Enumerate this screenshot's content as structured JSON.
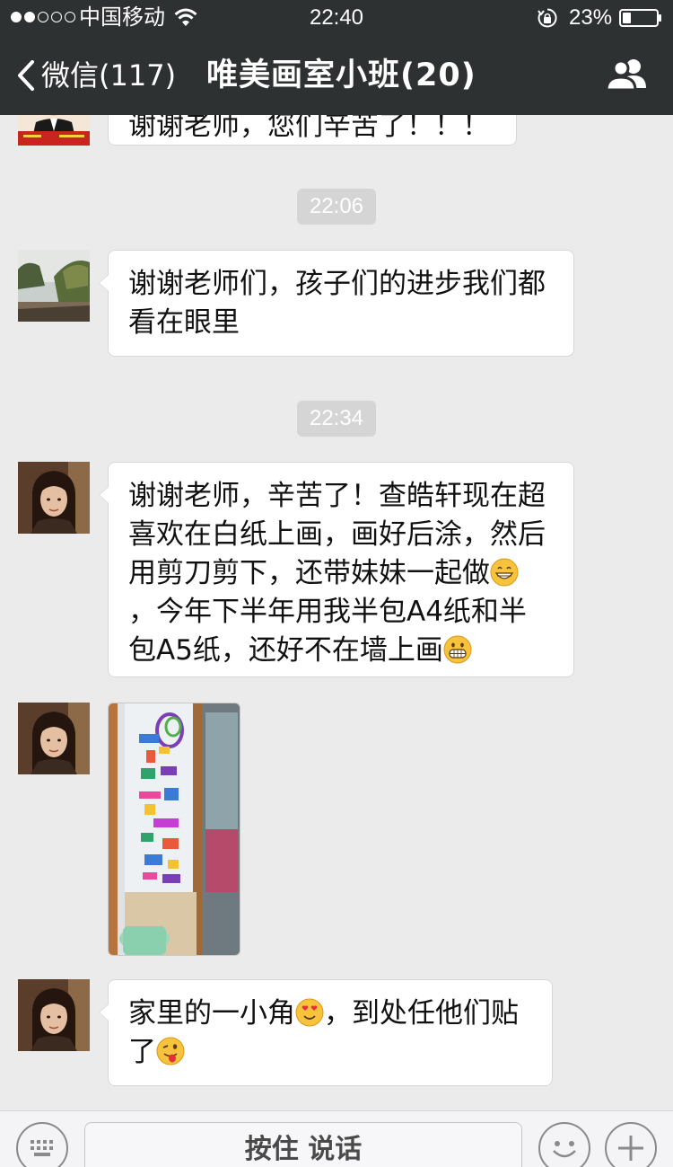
{
  "status_bar": {
    "carrier": "中国移动",
    "time": "22:40",
    "battery": "23%"
  },
  "nav": {
    "back_label": "微信(117)",
    "title": "唯美画室小班(20)",
    "icons": {
      "back": "chevron-left-icon",
      "group": "group-members-icon"
    }
  },
  "messages": {
    "partial_top": "谢谢老师，您们辛苦了！！！",
    "ts1": "22:06",
    "m1_line1": "谢谢老师们，孩子们的进步我们都",
    "m1_line2": "看在眼里",
    "ts2": "22:34",
    "m2_line1": "谢谢老师，辛苦了！查皓轩现在超",
    "m2_line2": "喜欢在白纸上画，画好后涂，然后",
    "m2_line3": "用剪刀剪下，还带妹妹一起做",
    "m2_line4": "，今年下半年用我半包A4纸和半",
    "m2_line5": "包A5纸，还好不在墙上画",
    "m4_part1": "家里的一小角",
    "m4_part2": "，到处任他们贴",
    "m4_part3": "了"
  },
  "input_bar": {
    "hold_to_talk": "按住 说话",
    "icons": {
      "keyboard": "keyboard-icon",
      "emoji": "emoji-icon",
      "more": "plus-icon"
    }
  },
  "colors": {
    "bar_bg": "#2e3132",
    "chat_bg": "#ebebeb",
    "bubble_bg": "#ffffff",
    "timestamp_bg": "#d5d5d5"
  }
}
